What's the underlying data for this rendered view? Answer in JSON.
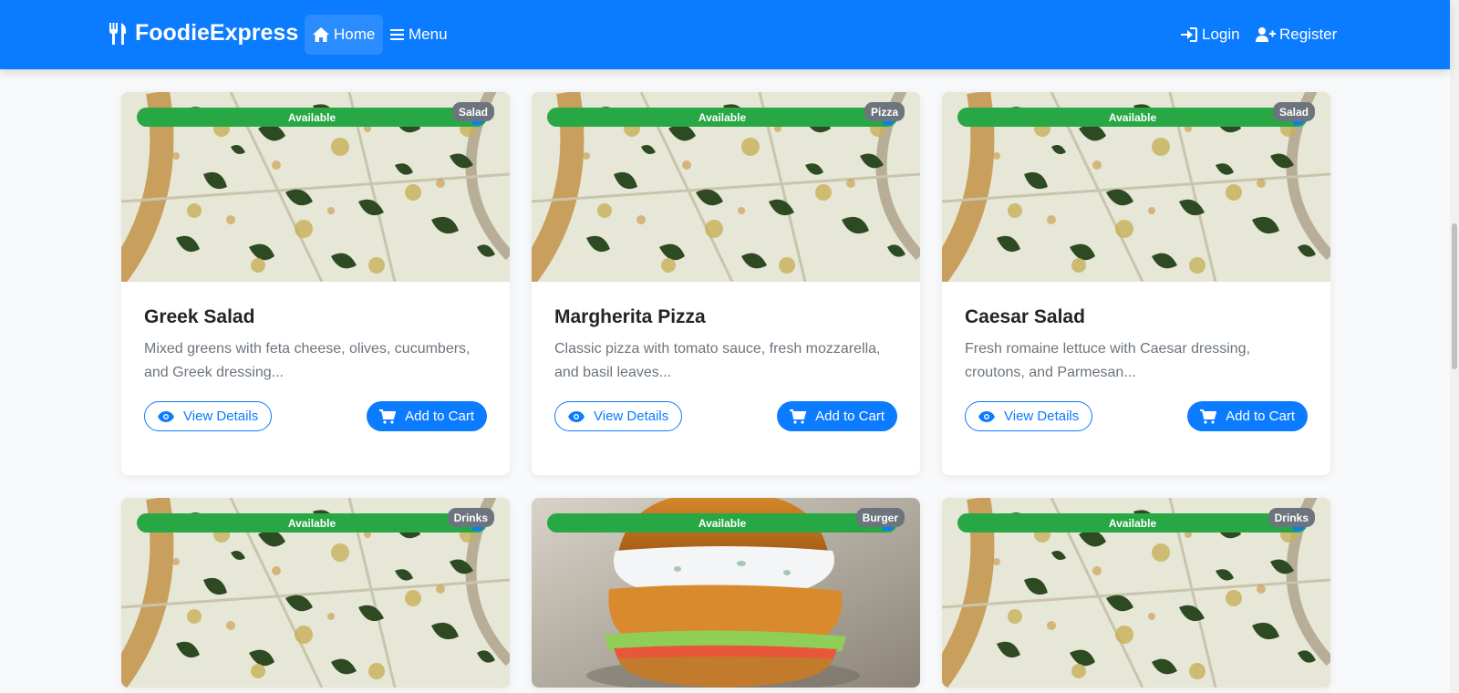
{
  "navbar": {
    "brand": "FoodieExpress",
    "home": "Home",
    "menu": "Menu",
    "login": "Login",
    "register": "Register",
    "color": "#0b7bff"
  },
  "cards": [
    {
      "title": "Greek Salad",
      "description": "Mixed greens with feta cheese, olives, cucumbers, and Greek dressing...",
      "availability": "Available",
      "category": "Salad",
      "image": "pizza",
      "view_label": "View Details",
      "cart_label": "Add to Cart"
    },
    {
      "title": "Margherita Pizza",
      "description": "Classic pizza with tomato sauce, fresh mozzarella, and basil leaves...",
      "availability": "Available",
      "category": "Pizza",
      "image": "pizza",
      "view_label": "View Details",
      "cart_label": "Add to Cart"
    },
    {
      "title": "Caesar Salad",
      "description": "Fresh romaine lettuce with Caesar dressing, croutons, and Parmesan...",
      "availability": "Available",
      "category": "Salad",
      "image": "pizza",
      "view_label": "View Details",
      "cart_label": "Add to Cart"
    },
    {
      "title": "",
      "description": "",
      "availability": "Available",
      "category": "Drinks",
      "image": "pizza"
    },
    {
      "title": "",
      "description": "",
      "availability": "Available",
      "category": "Burger",
      "image": "burger"
    },
    {
      "title": "",
      "description": "",
      "availability": "Available",
      "category": "Drinks",
      "image": "pizza"
    }
  ],
  "colors": {
    "accent": "#0b7bff",
    "available": "#28a745",
    "category_badge": "#6c757d"
  }
}
